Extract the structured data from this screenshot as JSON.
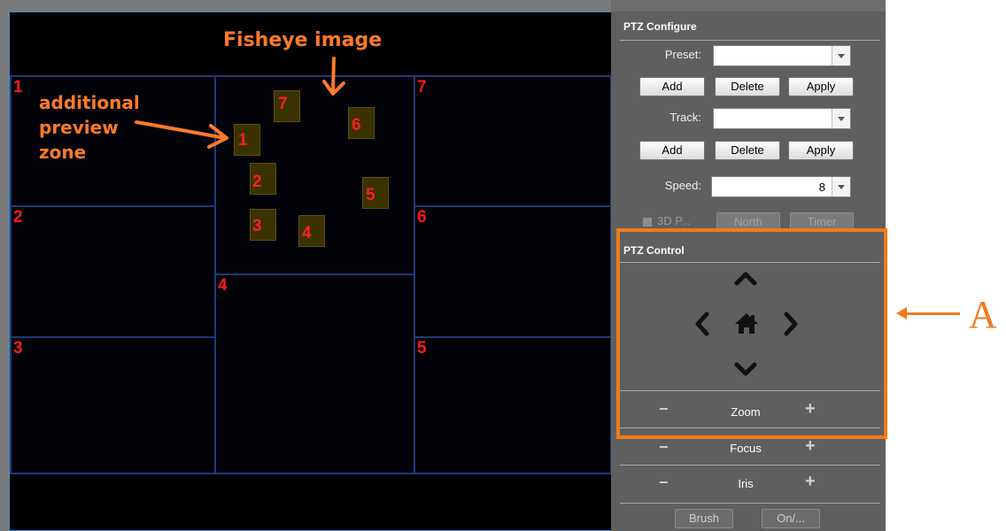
{
  "annotations": {
    "fisheye_title": "Fisheye image",
    "additional_zone_lines": [
      "additional",
      "preview",
      "zone"
    ],
    "highlight_label": "A",
    "color": "#ff7a2a"
  },
  "zones": {
    "numbers": [
      "1",
      "7",
      "2",
      "6",
      "4",
      "3",
      "5"
    ]
  },
  "fisheye": {
    "markers": [
      "7",
      "6",
      "1",
      "2",
      "5",
      "3",
      "4"
    ]
  },
  "ptz_configure": {
    "title": "PTZ Configure",
    "preset_label": "Preset:",
    "preset_value": "",
    "preset_buttons": [
      "Add",
      "Delete",
      "Apply"
    ],
    "track_label": "Track:",
    "track_value": "",
    "track_buttons": [
      "Add",
      "Delete",
      "Apply"
    ],
    "speed_label": "Speed:",
    "speed_value": "8",
    "option_3dp": "3D P...",
    "north_button": "North",
    "timer_button": "Timer"
  },
  "ptz_control": {
    "title": "PTZ Control",
    "directions": [
      "up",
      "left",
      "home",
      "right",
      "down"
    ],
    "zoom_label": "Zoom",
    "focus_label": "Focus",
    "iris_label": "Iris",
    "minus": "−",
    "plus": "+",
    "brush_button": "Brush",
    "onoff_button": "On/..."
  }
}
